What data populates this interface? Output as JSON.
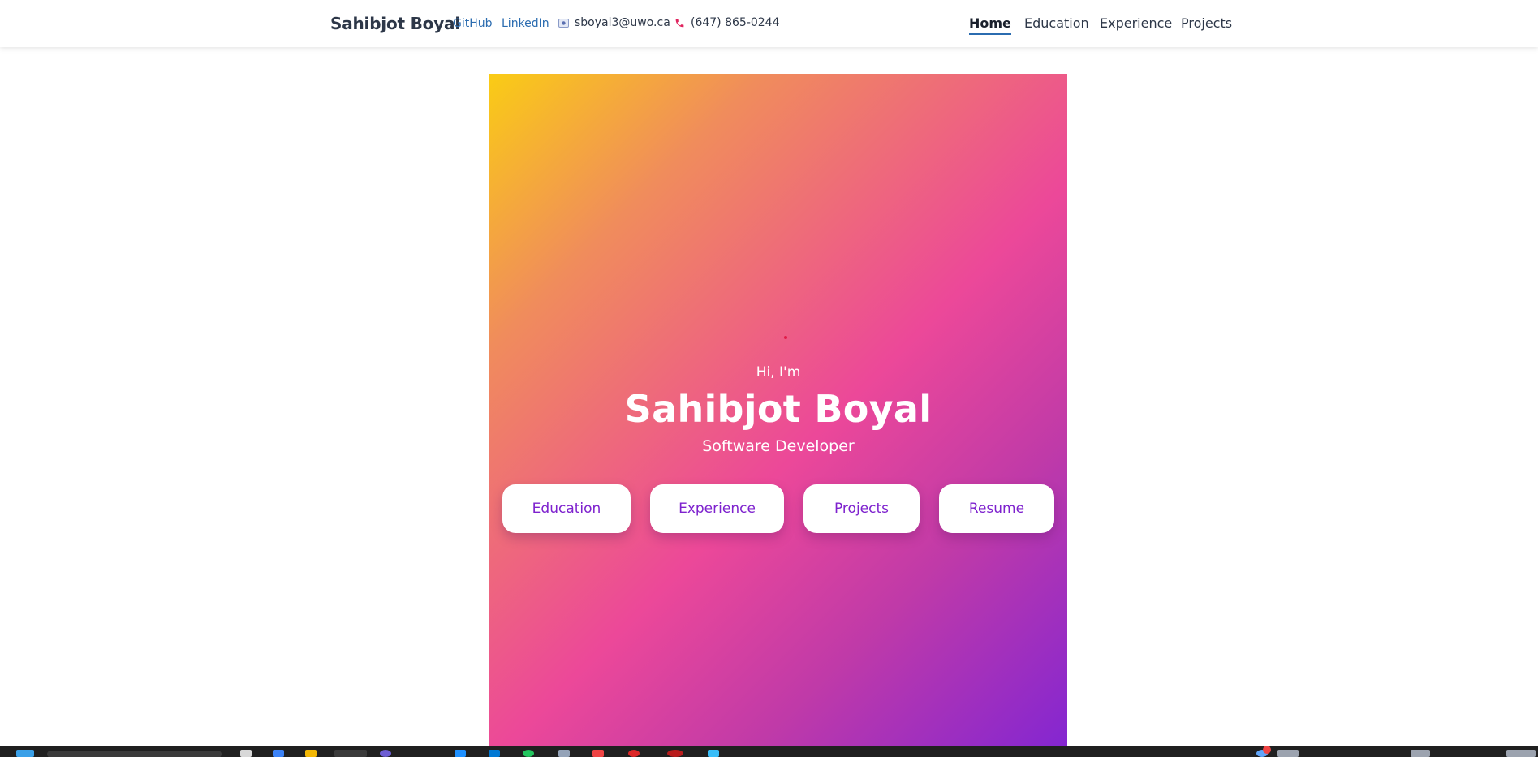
{
  "nav": {
    "brand": "Sahibjot Boyal",
    "links": [
      {
        "label": "GitHub"
      },
      {
        "label": "LinkedIn"
      }
    ],
    "email": {
      "icon": "email-icon",
      "text": "sboyal3@uwo.ca"
    },
    "phone": {
      "icon": "phone-icon",
      "text": "(647) 865-0244"
    },
    "menu": [
      {
        "label": "Home",
        "active": true
      },
      {
        "label": "Education",
        "active": false
      },
      {
        "label": "Experience",
        "active": false
      },
      {
        "label": "Projects",
        "active": false
      }
    ]
  },
  "hero": {
    "greeting": "Hi, I'm",
    "name": "Sahibjot Boyal",
    "role": "Software Developer",
    "buttons": [
      {
        "label": "Education"
      },
      {
        "label": "Experience"
      },
      {
        "label": "Projects"
      },
      {
        "label": "Resume"
      }
    ],
    "gradient_colors": [
      "#facc15",
      "#ec4899",
      "#8426d1"
    ]
  },
  "colors": {
    "link": "#2b6cb0",
    "text": "#2d3748",
    "button_text": "#7e22ce",
    "taskbar": "#202020"
  }
}
